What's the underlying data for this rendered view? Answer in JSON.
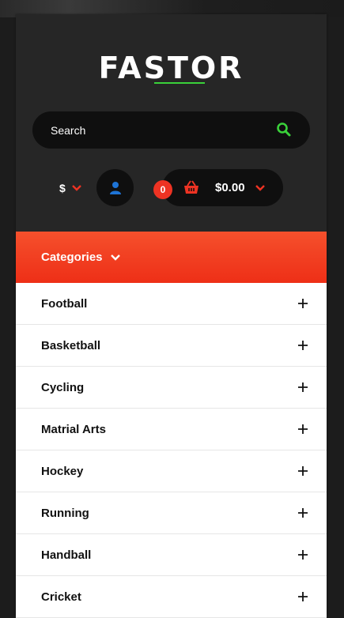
{
  "brand": {
    "logo_text": "FASTOR",
    "accent": "#3ad13a"
  },
  "search": {
    "placeholder": "Search",
    "icon": "search-icon"
  },
  "currency": {
    "symbol": "$"
  },
  "account": {
    "icon": "user-icon"
  },
  "cart": {
    "count": "0",
    "total": "$0.00",
    "icon": "basket-icon"
  },
  "categories": {
    "label": "Categories",
    "items": [
      {
        "label": "Football"
      },
      {
        "label": "Basketball"
      },
      {
        "label": "Cycling"
      },
      {
        "label": "Matrial Arts"
      },
      {
        "label": "Hockey"
      },
      {
        "label": "Running"
      },
      {
        "label": "Handball"
      },
      {
        "label": "Cricket"
      }
    ]
  },
  "colors": {
    "primary": "#ee3323",
    "panel": "#262626",
    "dark": "#0f0f0f"
  }
}
